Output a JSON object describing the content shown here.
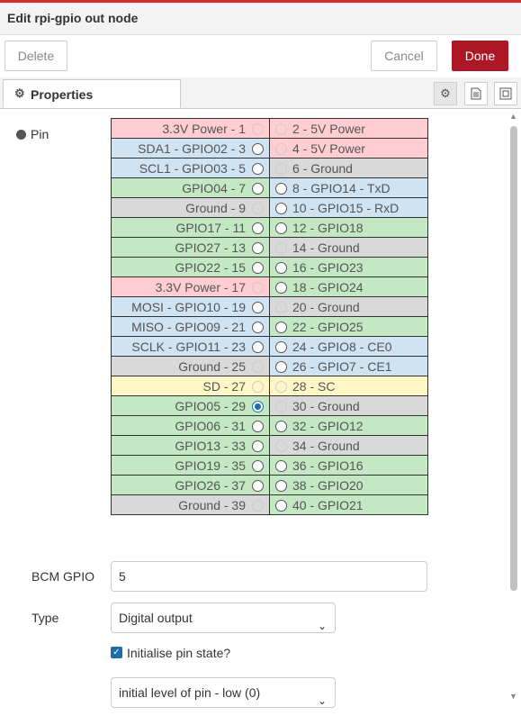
{
  "title": "Edit rpi-gpio out node",
  "buttons": {
    "delete": "Delete",
    "cancel": "Cancel",
    "done": "Done"
  },
  "tabs": [
    {
      "label": "Properties",
      "icon": "gear-icon"
    }
  ],
  "toolbar_icons": [
    "gear-icon",
    "document-icon",
    "frame-icon"
  ],
  "form": {
    "pin_label": "Pin",
    "bcm_label": "BCM GPIO",
    "bcm_value": "5",
    "type_label": "Type",
    "type_value": "Digital output",
    "init_label": "Initialise pin state?",
    "init_checked": true,
    "level_value": "initial level of pin - low (0)"
  },
  "pin_rows": [
    {
      "left": "3.3V Power - 1",
      "lc": "red",
      "ls": "disabled",
      "right": "2 - 5V Power",
      "rc": "red",
      "rs": "disabled"
    },
    {
      "left": "SDA1 - GPIO02 - 3",
      "lc": "blue",
      "ls": "enabled",
      "right": "4 - 5V Power",
      "rc": "red",
      "rs": "disabled"
    },
    {
      "left": "SCL1 - GPIO03 - 5",
      "lc": "blue",
      "ls": "enabled",
      "right": "6 - Ground",
      "rc": "grey",
      "rs": "disabled"
    },
    {
      "left": "GPIO04 - 7",
      "lc": "green",
      "ls": "enabled",
      "right": "8 - GPIO14 - TxD",
      "rc": "blue",
      "rs": "enabled"
    },
    {
      "left": "Ground - 9",
      "lc": "grey",
      "ls": "disabled",
      "right": "10 - GPIO15 - RxD",
      "rc": "blue",
      "rs": "enabled"
    },
    {
      "left": "GPIO17 - 11",
      "lc": "green",
      "ls": "enabled",
      "right": "12 - GPIO18",
      "rc": "green",
      "rs": "enabled"
    },
    {
      "left": "GPIO27 - 13",
      "lc": "green",
      "ls": "enabled",
      "right": "14 - Ground",
      "rc": "grey",
      "rs": "disabled"
    },
    {
      "left": "GPIO22 - 15",
      "lc": "green",
      "ls": "enabled",
      "right": "16 - GPIO23",
      "rc": "green",
      "rs": "enabled"
    },
    {
      "left": "3.3V Power - 17",
      "lc": "red",
      "ls": "disabled",
      "right": "18 - GPIO24",
      "rc": "green",
      "rs": "enabled"
    },
    {
      "left": "MOSI - GPIO10 - 19",
      "lc": "blue",
      "ls": "enabled",
      "right": "20 - Ground",
      "rc": "grey",
      "rs": "disabled"
    },
    {
      "left": "MISO - GPIO09 - 21",
      "lc": "blue",
      "ls": "enabled",
      "right": "22 - GPIO25",
      "rc": "green",
      "rs": "enabled"
    },
    {
      "left": "SCLK - GPIO11 - 23",
      "lc": "blue",
      "ls": "enabled",
      "right": "24 - GPIO8 - CE0",
      "rc": "blue",
      "rs": "enabled"
    },
    {
      "left": "Ground - 25",
      "lc": "grey",
      "ls": "disabled",
      "right": "26 - GPIO7 - CE1",
      "rc": "blue",
      "rs": "enabled"
    },
    {
      "left": "SD - 27",
      "lc": "yellow",
      "ls": "disabled",
      "right": "28 - SC",
      "rc": "yellow",
      "rs": "disabled"
    },
    {
      "left": "GPIO05 - 29",
      "lc": "green",
      "ls": "selected",
      "right": "30 - Ground",
      "rc": "grey",
      "rs": "disabled"
    },
    {
      "left": "GPIO06 - 31",
      "lc": "green",
      "ls": "enabled",
      "right": "32 - GPIO12",
      "rc": "green",
      "rs": "enabled"
    },
    {
      "left": "GPIO13 - 33",
      "lc": "green",
      "ls": "enabled",
      "right": "34 - Ground",
      "rc": "grey",
      "rs": "disabled"
    },
    {
      "left": "GPIO19 - 35",
      "lc": "green",
      "ls": "enabled",
      "right": "36 - GPIO16",
      "rc": "green",
      "rs": "enabled"
    },
    {
      "left": "GPIO26 - 37",
      "lc": "green",
      "ls": "enabled",
      "right": "38 - GPIO20",
      "rc": "green",
      "rs": "enabled"
    },
    {
      "left": "Ground - 39",
      "lc": "grey",
      "ls": "disabled",
      "right": "40 - GPIO21",
      "rc": "green",
      "rs": "enabled"
    }
  ],
  "colors": {
    "accent": "#ad1625",
    "top_line": "#d12b2b",
    "selected": "#1a6fa8"
  }
}
